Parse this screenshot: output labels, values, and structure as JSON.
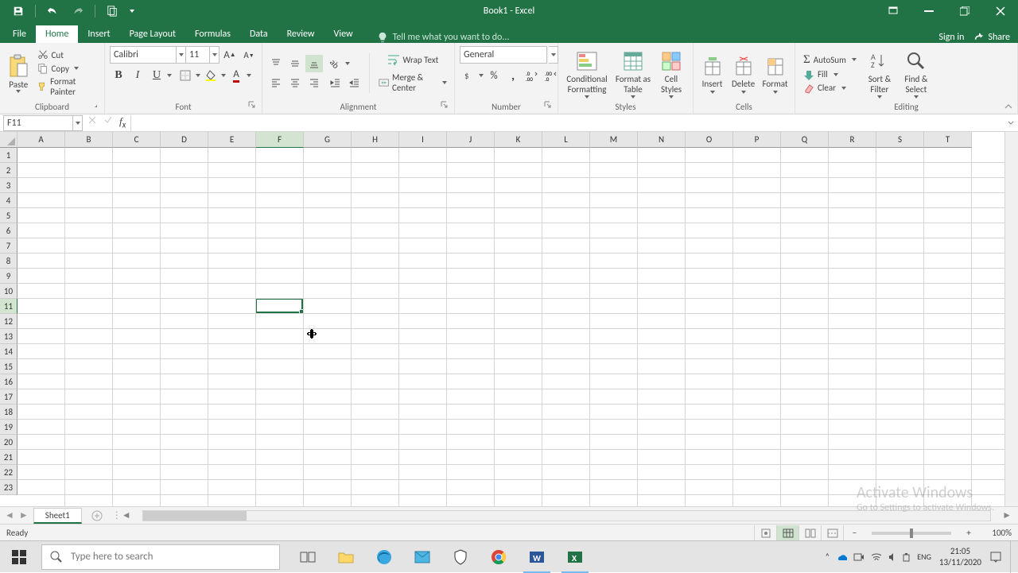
{
  "title": "Book1 - Excel",
  "qat": {
    "save": "Save",
    "undo": "Undo",
    "redo": "Redo",
    "touch": "Touch/Mouse Mode"
  },
  "tabs": [
    "File",
    "Home",
    "Insert",
    "Page Layout",
    "Formulas",
    "Data",
    "Review",
    "View"
  ],
  "active_tab": "Home",
  "tellme": "Tell me what you want to do...",
  "signin": "Sign in",
  "share": "Share",
  "ribbon": {
    "clipboard": {
      "paste": "Paste",
      "cut": "Cut",
      "copy": "Copy",
      "painter": "Format Painter",
      "label": "Clipboard"
    },
    "font": {
      "name": "Calibri",
      "size": "11",
      "label": "Font"
    },
    "alignment": {
      "wrap": "Wrap Text",
      "merge": "Merge & Center",
      "label": "Alignment"
    },
    "number": {
      "format": "General",
      "label": "Number"
    },
    "styles": {
      "cond": "Conditional Formatting",
      "table": "Format as Table",
      "cell": "Cell Styles",
      "label": "Styles"
    },
    "cells": {
      "insert": "Insert",
      "delete": "Delete",
      "format": "Format",
      "label": "Cells"
    },
    "editing": {
      "autosum": "AutoSum",
      "fill": "Fill",
      "clear": "Clear",
      "sort": "Sort & Filter",
      "find": "Find & Select",
      "label": "Editing"
    }
  },
  "namebox": "F11",
  "columns": [
    "A",
    "B",
    "C",
    "D",
    "E",
    "F",
    "G",
    "H",
    "I",
    "J",
    "K",
    "L",
    "M",
    "N",
    "O",
    "P",
    "Q",
    "R",
    "S",
    "T"
  ],
  "rows": 23,
  "selected": {
    "col": "F",
    "colIndex": 5,
    "row": 11
  },
  "sheet_tab": "Sheet1",
  "status": "Ready",
  "zoom": "100%",
  "watermark": {
    "title": "Activate Windows",
    "sub": "Go to Settings to activate Windows."
  },
  "taskbar": {
    "search_placeholder": "Type here to search",
    "time": "21:05",
    "date": "13/11/2020"
  }
}
